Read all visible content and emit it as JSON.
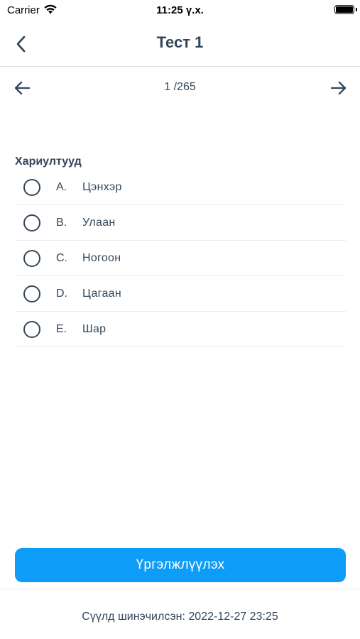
{
  "status_bar": {
    "carrier": "Carrier",
    "time": "11:25 ү.х."
  },
  "nav": {
    "title": "Тест 1",
    "back_icon": "chevron-left-icon"
  },
  "pager": {
    "page_text": "1 /265",
    "prev_icon": "arrow-left-icon",
    "next_icon": "arrow-right-icon"
  },
  "answers": {
    "heading": "Хариултууд",
    "options": [
      {
        "letter": "A.",
        "text": "Цэнхэр",
        "selected": false
      },
      {
        "letter": "B.",
        "text": "Улаан",
        "selected": false
      },
      {
        "letter": "C.",
        "text": "Ногоон",
        "selected": false
      },
      {
        "letter": "D.",
        "text": "Цагаан",
        "selected": false
      },
      {
        "letter": "E.",
        "text": "Шар",
        "selected": false
      }
    ]
  },
  "continue_button": {
    "label": "Үргэлжлүүлэх"
  },
  "footer": {
    "last_updated": "Сүүлд шинэчилсэн: 2022-12-27 23:25"
  },
  "colors": {
    "primary": "#0d9cf7",
    "text": "#33475b",
    "divider": "#ececec"
  }
}
